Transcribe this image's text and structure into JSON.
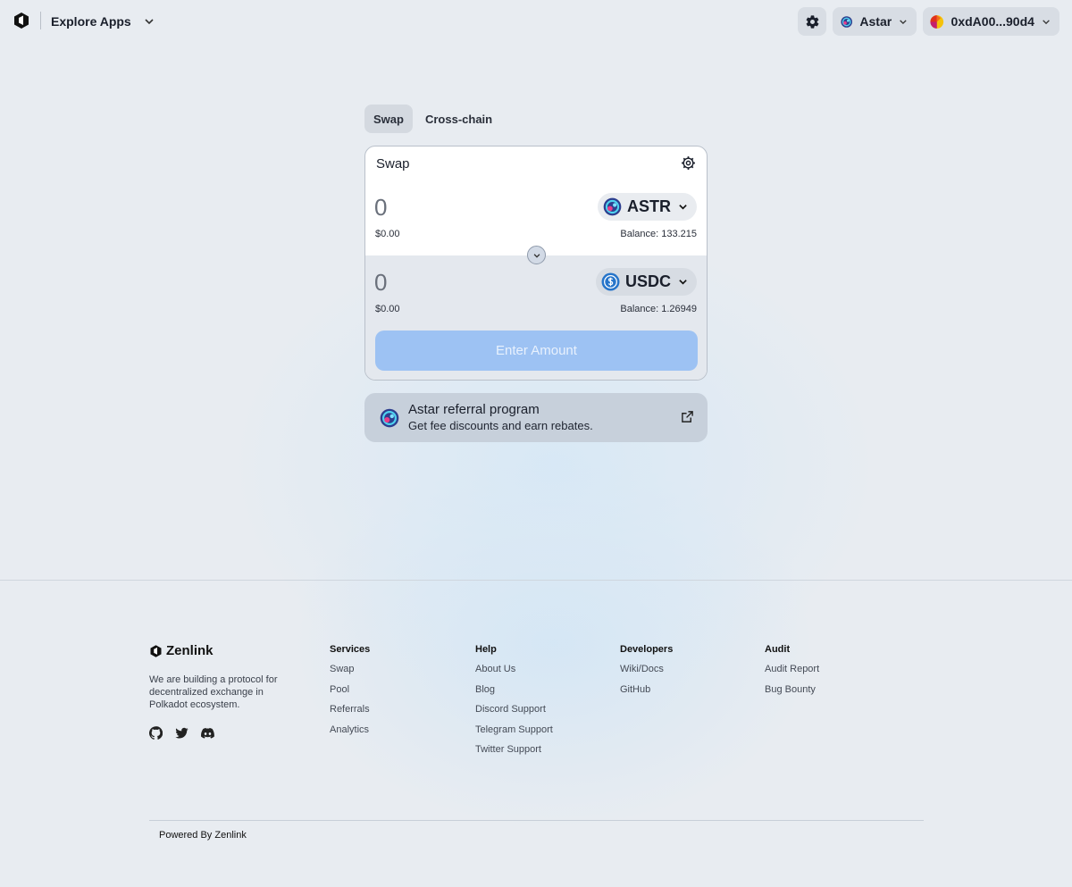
{
  "header": {
    "explore_label": "Explore Apps",
    "network_label": "Astar",
    "wallet_label": "0xdA00...90d4"
  },
  "tabs": [
    {
      "label": "Swap",
      "active": true
    },
    {
      "label": "Cross-chain",
      "active": false
    }
  ],
  "swap": {
    "title": "Swap",
    "from": {
      "amount_placeholder": "0",
      "usd_value": "$0.00",
      "token": "ASTR",
      "balance": "Balance: 133.215"
    },
    "to": {
      "amount_placeholder": "0",
      "usd_value": "$0.00",
      "token": "USDC",
      "balance": "Balance: 1.26949"
    },
    "submit_label": "Enter Amount"
  },
  "referral": {
    "title": "Astar referral program",
    "subtitle": "Get fee discounts and earn rebates."
  },
  "footer": {
    "brand": "Zenlink",
    "description": "We are building a protocol for decentralized exchange in Polkadot ecosystem.",
    "columns": [
      {
        "title": "Services",
        "links": [
          "Swap",
          "Pool",
          "Referrals",
          "Analytics"
        ]
      },
      {
        "title": "Help",
        "links": [
          "About Us",
          "Blog",
          "Discord Support",
          "Telegram Support",
          "Twitter Support"
        ]
      },
      {
        "title": "Developers",
        "links": [
          "Wiki/Docs",
          "GitHub"
        ]
      },
      {
        "title": "Audit",
        "links": [
          "Audit Report",
          "Bug Bounty"
        ]
      }
    ],
    "powered_by": "Powered By Zenlink"
  },
  "colors": {
    "accent_button": "#9dc2f3",
    "background": "#e8ecf1",
    "usdc_blue": "#2775ca"
  },
  "icons": [
    "zenlink-logo-icon",
    "chevron-down-icon",
    "gear-icon",
    "astar-icon",
    "wallet-avatar-icon",
    "usdc-icon",
    "external-link-icon",
    "github-icon",
    "twitter-icon",
    "discord-icon"
  ]
}
